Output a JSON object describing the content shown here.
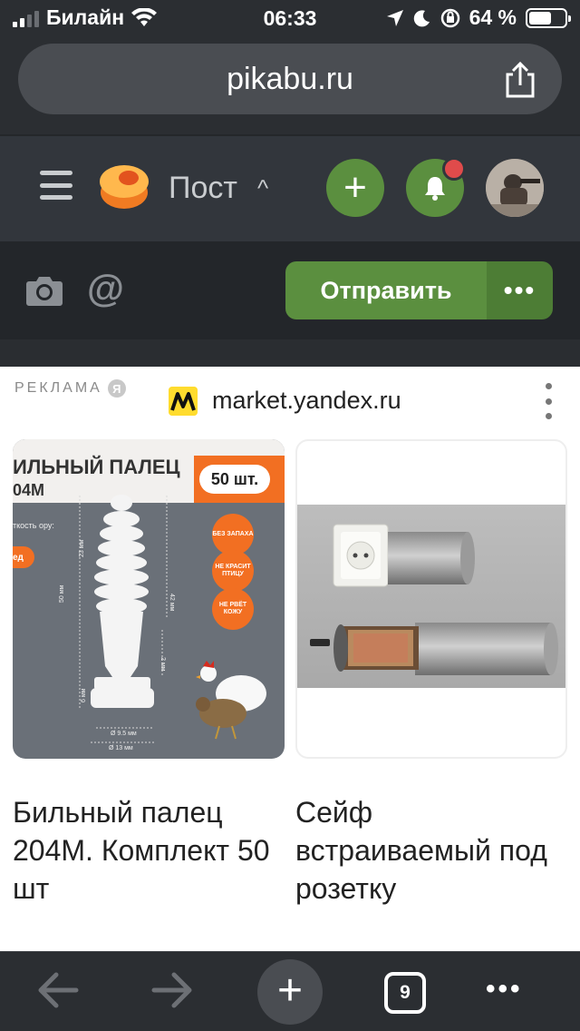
{
  "status_bar": {
    "carrier": "Билайн",
    "time": "06:33",
    "battery_percent": "64 %",
    "battery_level": 0.64,
    "icons": [
      "signal-icon",
      "wifi-icon",
      "location-icon",
      "moon-icon",
      "rotation-lock-icon",
      "battery-icon"
    ]
  },
  "browser": {
    "url": "pikabu.ru",
    "share_icon": "share-icon",
    "tabs_count": "9",
    "bottom_icons": [
      "back-arrow-icon",
      "forward-arrow-icon",
      "new-tab-plus-icon",
      "tabs-icon",
      "more-icon"
    ]
  },
  "app_header": {
    "menu_icon": "hamburger-icon",
    "logo": "pikabu-logo",
    "title": "Пост",
    "title_chevron": "^",
    "add_button": "+",
    "notifications_icon": "bell-icon",
    "has_notification_badge": true,
    "accent_color": "#5b8f3f"
  },
  "composer": {
    "camera_icon": "camera-icon",
    "mention_label": "@",
    "send_label": "Отправить",
    "more_label": "•••"
  },
  "ad": {
    "label": "РЕКЛАМА",
    "badge": "Я",
    "domain": "market.yandex.ru",
    "products": [
      {
        "caption": "Бильный палец 204М. Комплект 50 шт",
        "image_text": {
          "title_line1": "ИЛЬНЫЙ ПАЛЕЦ",
          "title_line2": "04М",
          "count": "50 шт.",
          "tags": [
            "БЕЗ ЗАПАХА",
            "НЕ КРАСИТ ПТИЦУ",
            "НЕ РВЁТ КОЖУ"
          ],
          "side_text": "ткость ору:",
          "side_badge": "ед",
          "dims": [
            "23 мм",
            "50 мм",
            "42 мм",
            "2 мм",
            "6 мм",
            "Ø 9.5 мм",
            "Ø 13 мм"
          ]
        }
      },
      {
        "caption": "Сейф встраиваемый под розетку"
      }
    ]
  }
}
